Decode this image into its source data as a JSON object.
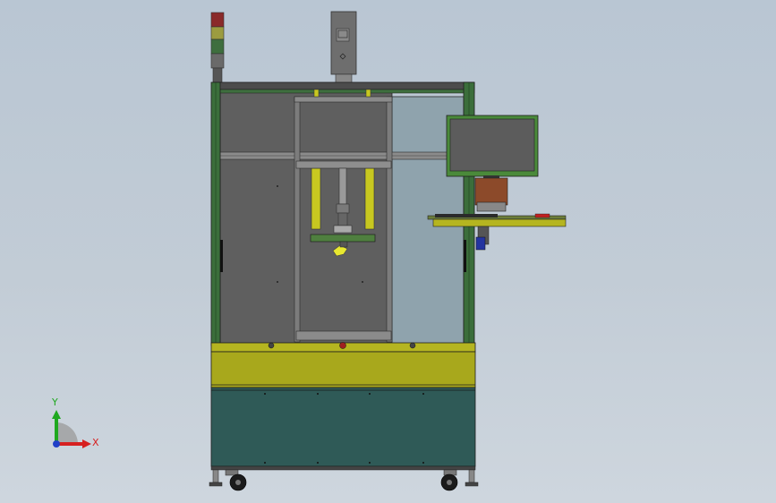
{
  "triad": {
    "x_label": "X",
    "y_label": "Y",
    "x_color": "#d62020",
    "y_color": "#1fa81f",
    "z_color": "#2040c8"
  },
  "colors": {
    "background_top": "#b9c6d3",
    "frame_green": "#3b6e3b",
    "panel_grey": "#5f5f5f",
    "glass": "#8fa3ad",
    "yellow_bed": "#b5b520",
    "teal_cabinet": "#2f5a57",
    "monitor_frame": "#4a8a3a"
  },
  "light_tower": {
    "segments": [
      "red",
      "yellow",
      "green",
      "grey"
    ]
  }
}
